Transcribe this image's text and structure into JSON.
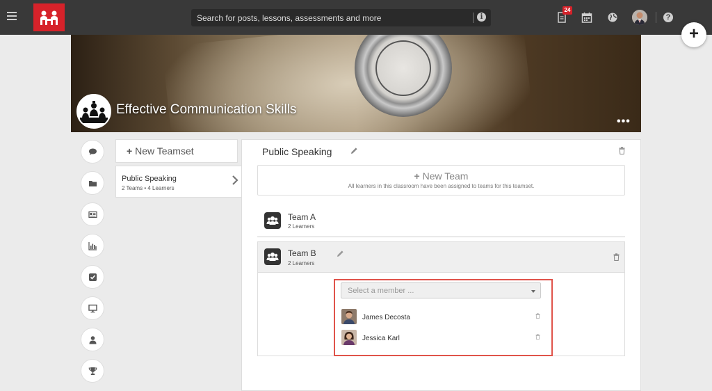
{
  "topbar": {
    "search_placeholder": "Search for posts, lessons, assessments and more",
    "notification_count": "24",
    "info_glyph": "i",
    "help_glyph": "?",
    "fab_glyph": "+",
    "icons": [
      "menu-icon",
      "logo-icon",
      "info-icon",
      "document-icon",
      "calendar-icon",
      "globe-icon",
      "user-avatar",
      "help-icon"
    ]
  },
  "course": {
    "title": "Effective Communication Skills",
    "menu_glyph": "•••"
  },
  "sidebar": {
    "icons": [
      "comment-icon",
      "folder-icon",
      "newspaper-icon",
      "bar-chart-icon",
      "checkbox-icon",
      "monitor-icon",
      "user-icon",
      "trophy-icon"
    ]
  },
  "teamsets": {
    "new_label": "New Teamset",
    "items": [
      {
        "name": "Public Speaking",
        "meta": "2 Teams • 4 Learners"
      }
    ]
  },
  "panel": {
    "title": "Public Speaking",
    "new_team_label": "New Team",
    "new_team_sub": "All learners in this classroom have been assigned to teams for this teamset.",
    "teams": [
      {
        "name": "Team A",
        "meta": "2 Learners"
      },
      {
        "name": "Team B",
        "meta": "2 Learners"
      }
    ],
    "member_select_placeholder": "Select a member ...",
    "members": [
      {
        "name": "James Decosta"
      },
      {
        "name": "Jessica Karl"
      }
    ]
  },
  "colors": {
    "topbar": "#393939",
    "brand": "#d6222a",
    "highlight": "#e0534a"
  }
}
